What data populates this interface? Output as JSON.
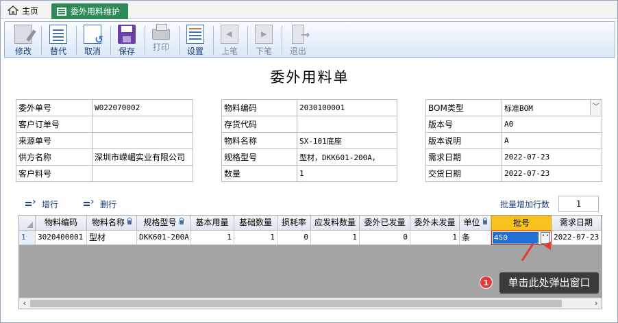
{
  "tabs": {
    "home_label": "主页",
    "active_label": "委外用料维护"
  },
  "toolbar": {
    "buttons": [
      {
        "label": "修改",
        "icon": "edit-icon",
        "enabled": true
      },
      {
        "label": "替代",
        "icon": "document-icon",
        "enabled": true
      },
      {
        "label": "取消",
        "icon": "undo-icon",
        "enabled": true
      },
      {
        "label": "保存",
        "icon": "save-icon",
        "enabled": true
      },
      {
        "label": "打印",
        "icon": "print-icon",
        "enabled": false
      },
      {
        "label": "设置",
        "icon": "settings-icon",
        "enabled": true
      },
      {
        "label": "上笔",
        "icon": "previous-icon",
        "enabled": false
      },
      {
        "label": "下笔",
        "icon": "next-icon",
        "enabled": false
      },
      {
        "label": "退出",
        "icon": "exit-icon",
        "enabled": false
      }
    ]
  },
  "form": {
    "title": "委外用料单",
    "left": [
      {
        "label": "委外单号",
        "value": "W022070002"
      },
      {
        "label": "客户订单号",
        "value": ""
      },
      {
        "label": "来源单号",
        "value": ""
      },
      {
        "label": "供方名称",
        "value": "深圳市嵘嵋实业有限公司"
      },
      {
        "label": "客户料号",
        "value": ""
      }
    ],
    "middle": [
      {
        "label": "物料编码",
        "value": "2030100001"
      },
      {
        "label": "存货代码",
        "value": ""
      },
      {
        "label": "物料名称",
        "value": "SX-101底座"
      },
      {
        "label": "规格型号",
        "value": "型材，DKK601-200A，"
      },
      {
        "label": "数量",
        "value": "1"
      }
    ],
    "right": [
      {
        "label": "BOM类型",
        "value": "标准BOM"
      },
      {
        "label": "版本号",
        "value": "A0"
      },
      {
        "label": "版本说明",
        "value": "A"
      },
      {
        "label": "需求日期",
        "value": "2022-07-23"
      },
      {
        "label": "交货日期",
        "value": "2022-07-23"
      }
    ]
  },
  "grid_toolbar": {
    "add_row_label": "增行",
    "delete_row_label": "删行",
    "batch_add_label": "批量增加行数",
    "batch_add_value": "1"
  },
  "grid": {
    "columns": [
      "物料编码",
      "物料名称",
      "规格型号",
      "基本用量",
      "基础数量",
      "损耗率",
      "应发料数量",
      "委外已发量",
      "委外未发量",
      "单位",
      "批号",
      "需求日期"
    ],
    "rows": [
      {
        "row_number": "1",
        "cells": [
          "3020400001",
          "型材",
          "DKK601-200A",
          "1",
          "1",
          "0",
          "1",
          "0",
          "1",
          "条",
          "450",
          "2022-07-23"
        ]
      }
    ],
    "lot_button_label": "···"
  },
  "annotation": {
    "badge": "1",
    "text": "单击此处弹出窗口"
  },
  "colors": {
    "active_tab": "#2e8b57",
    "highlight_header": "#f7c21e",
    "annotation_red": "#e53935",
    "callout_bg": "#3b3b3b"
  }
}
